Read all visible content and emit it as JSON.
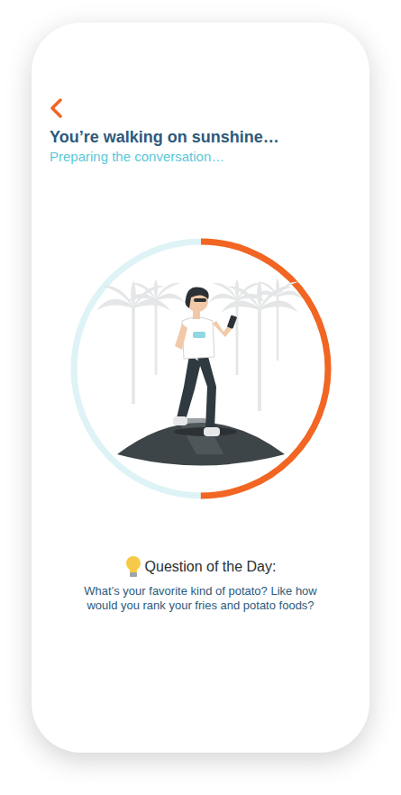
{
  "header": {
    "title": "You’re walking on sunshine…",
    "subtitle": "Preparing the conversation…"
  },
  "progress": {
    "level": 0.5
  },
  "question": {
    "label": "Question of the Day:",
    "text": "What’s your favorite kind of potato? Like how would you rank your fries and potato foods?"
  }
}
